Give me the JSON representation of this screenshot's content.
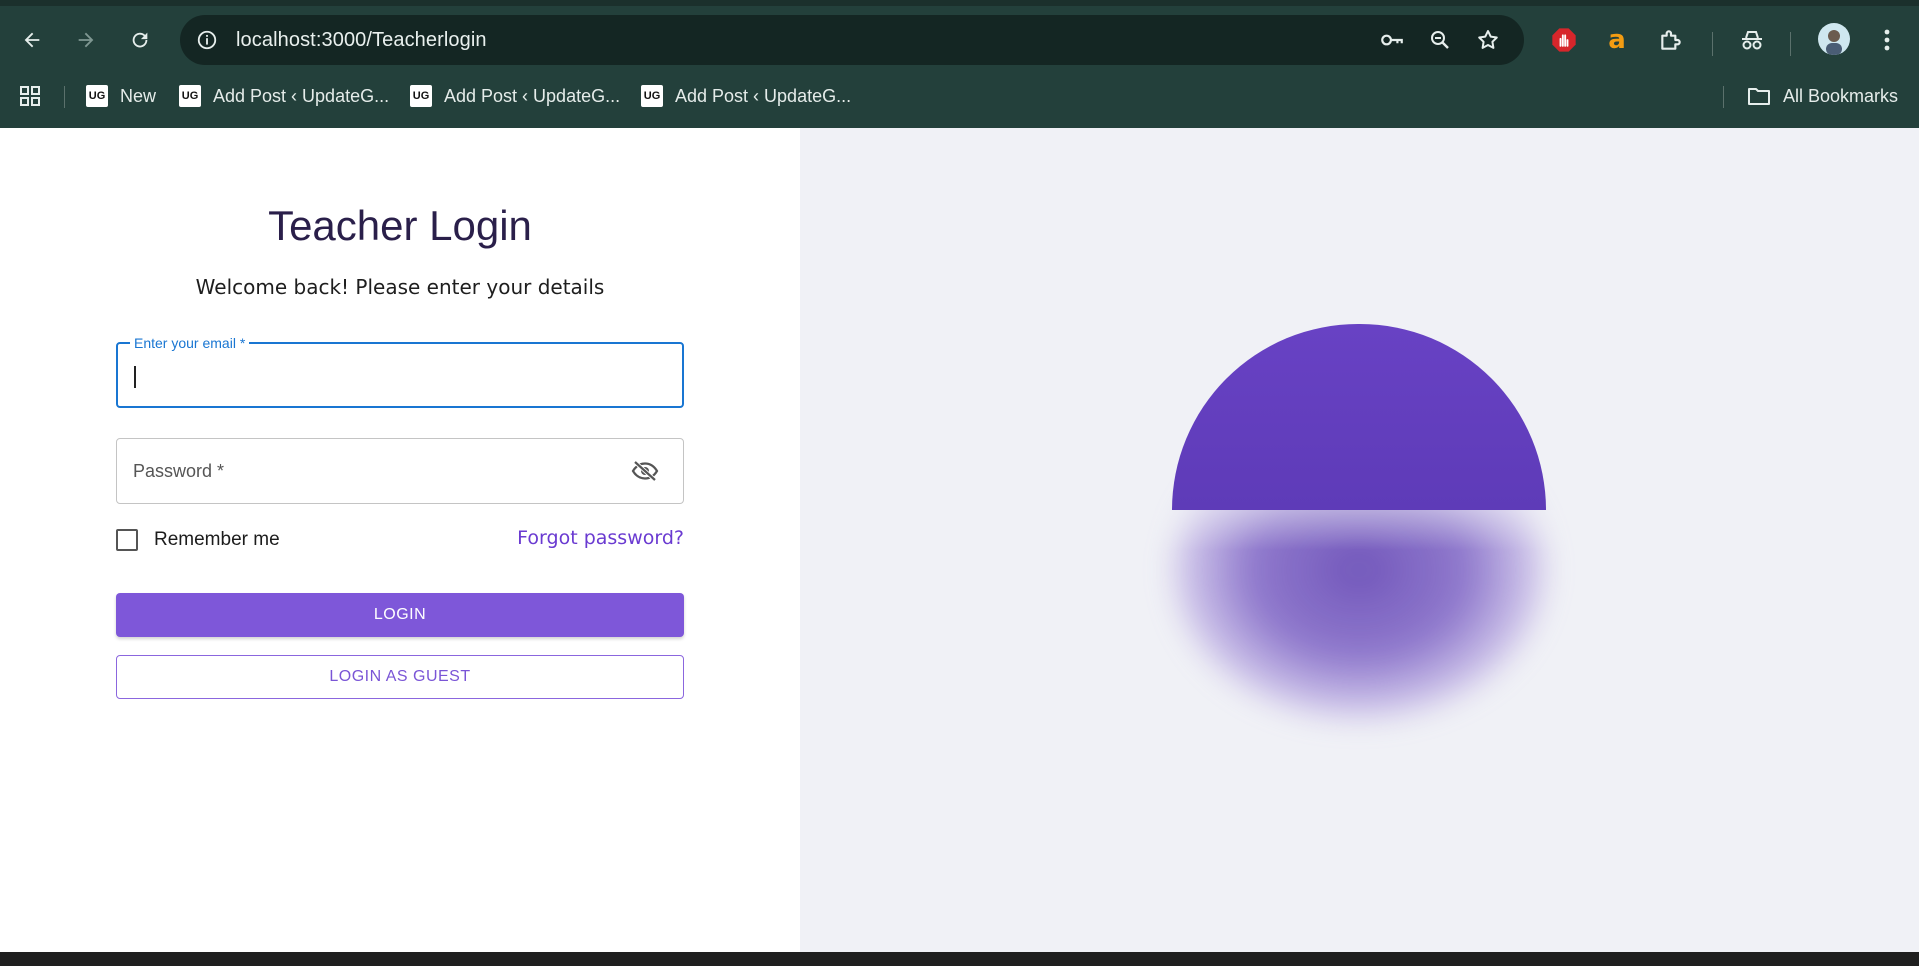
{
  "browser": {
    "url": "localhost:3000/Teacherlogin",
    "bookmarks": [
      {
        "label": "New",
        "favicon": "UG"
      },
      {
        "label": "Add Post ‹ UpdateG...",
        "favicon": "UG"
      },
      {
        "label": "Add Post ‹ UpdateG...",
        "favicon": "UG"
      },
      {
        "label": "Add Post ‹ UpdateG...",
        "favicon": "UG"
      }
    ],
    "all_bookmarks_label": "All Bookmarks"
  },
  "login": {
    "title": "Teacher Login",
    "subtitle": "Welcome back! Please enter your details",
    "email_label": "Enter your email *",
    "email_value": "",
    "password_placeholder": "Password *",
    "remember_label": "Remember me",
    "forgot_label": "Forgot password?",
    "login_button": "LOGIN",
    "guest_button": "LOGIN AS GUEST"
  },
  "colors": {
    "accent": "#7e57d9",
    "focus": "#1976d2",
    "orb": "#6842c4",
    "panel_bg": "#f0f1f6"
  }
}
